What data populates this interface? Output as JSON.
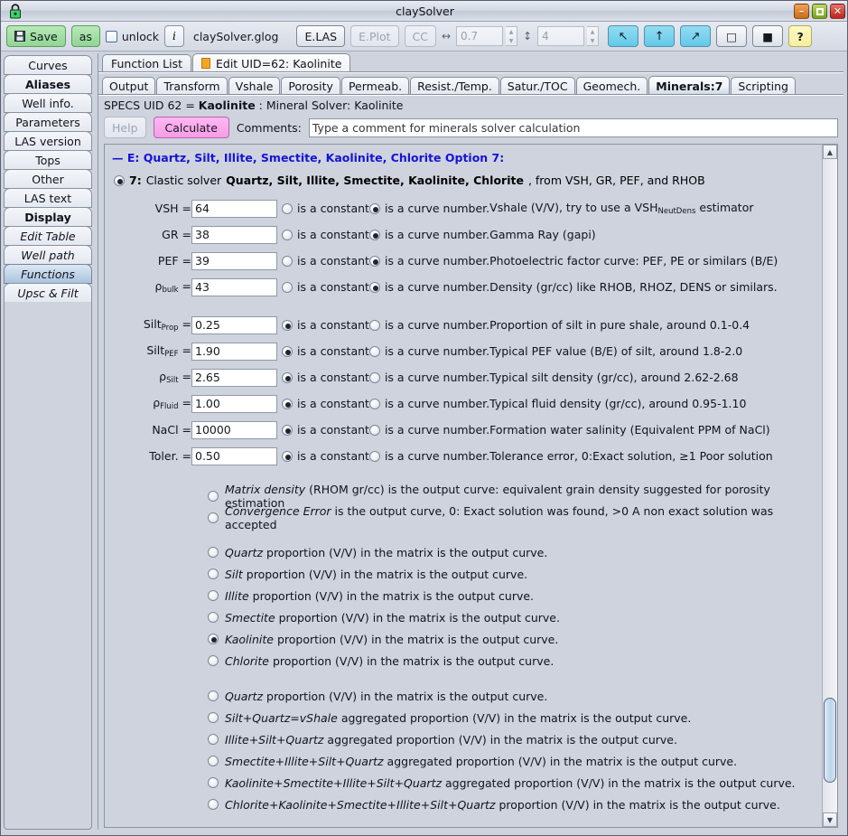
{
  "window": {
    "title": "claySolver",
    "lock_icon": "lock-icon",
    "minimize_label": "–",
    "maximize_label": "□",
    "close_label": "✕"
  },
  "toolbar": {
    "save_label": "Save",
    "save_icon": "floppy-disk-icon",
    "as_label": "as",
    "unlock_label": "unlock",
    "info_label": "i",
    "filename": "claySolver.glog",
    "elas_label": "E.LAS",
    "eplot_label": "E.Plot",
    "cc_label": "CC",
    "width_symbol": "↔",
    "width_value": "0.7",
    "height_symbol": "↕",
    "height_value": "4",
    "nav_back_label": "↖",
    "nav_up_label": "↑",
    "nav_fwd_label": "↗",
    "outline_label": "□",
    "filled_label": "■",
    "help_label": "?"
  },
  "sidebar": {
    "items": [
      {
        "label": "Curves",
        "style": "normal",
        "active": false
      },
      {
        "label": "Aliases",
        "style": "bold",
        "active": false
      },
      {
        "label": "Well info.",
        "style": "normal",
        "active": false
      },
      {
        "label": "Parameters",
        "style": "normal",
        "active": false
      },
      {
        "label": "LAS version",
        "style": "normal",
        "active": false
      },
      {
        "label": "Tops",
        "style": "normal",
        "active": false
      },
      {
        "label": "Other",
        "style": "normal",
        "active": false
      },
      {
        "label": "LAS text",
        "style": "normal",
        "active": false
      },
      {
        "label": "Display",
        "style": "bold",
        "active": false
      },
      {
        "label": "Edit Table",
        "style": "italic",
        "active": false
      },
      {
        "label": "Well path",
        "style": "italic",
        "active": false
      },
      {
        "label": "Functions",
        "style": "italic",
        "active": true
      },
      {
        "label": "Upsc & Filt",
        "style": "italic",
        "active": false
      }
    ]
  },
  "outer_tabs": [
    {
      "label": "Function List",
      "active": false,
      "marker": false
    },
    {
      "label": "Edit UID=62: Kaolinite",
      "active": true,
      "marker": true
    }
  ],
  "inner_tabs": [
    {
      "label": "Output",
      "active": false
    },
    {
      "label": "Transform",
      "active": false
    },
    {
      "label": "Vshale",
      "active": false
    },
    {
      "label": "Porosity",
      "active": false
    },
    {
      "label": "Permeab.",
      "active": false
    },
    {
      "label": "Resist./Temp.",
      "active": false
    },
    {
      "label": "Satur./TOC",
      "active": false
    },
    {
      "label": "Geomech.",
      "active": false
    },
    {
      "label": "Minerals:7",
      "active": true
    },
    {
      "label": "Scripting",
      "active": false
    }
  ],
  "specs": {
    "prefix": "SPECS UID 62 = ",
    "name": "Kaolinite",
    "suffix": " : Mineral Solver: Kaolinite"
  },
  "actions": {
    "help_label": "Help",
    "calculate_label": "Calculate",
    "comments_label": "Comments:",
    "comment_value": "Type a comment for minerals solver calculation"
  },
  "content": {
    "group_title": "— E: Quartz, Silt, Illite, Smectite, Kaolinite, Chlorite Option 7:",
    "option7": {
      "selected": true,
      "number": "7:",
      "text_before": "Clastic solver",
      "minerals": "Quartz, Silt, Illite, Smectite, Kaolinite, Chlorite",
      "text_after": ", from VSH, GR, PEF, and RHOB"
    },
    "constant_label": "is a constant",
    "curve_label": "is a curve number.",
    "params": [
      {
        "label": "VSH =",
        "label_sub": "",
        "value": "64",
        "mode": "curve",
        "desc_pre": "Vshale (V/V), try to use a VSH",
        "desc_sub": "NeutDens",
        "desc_post": " estimator"
      },
      {
        "label": "GR =",
        "label_sub": "",
        "value": "38",
        "mode": "curve",
        "desc_pre": "Gamma Ray (gapi)",
        "desc_sub": "",
        "desc_post": ""
      },
      {
        "label": "PEF =",
        "label_sub": "",
        "value": "39",
        "mode": "curve",
        "desc_pre": "Photoelectric factor curve: PEF, PE or similars (B/E)",
        "desc_sub": "",
        "desc_post": ""
      },
      {
        "label": "ρ",
        "label_sub": "bulk",
        "label_eq": " =",
        "value": "43",
        "mode": "curve",
        "desc_pre": "Density (gr/cc) like RHOB, RHOZ, DENS or similars.",
        "desc_sub": "",
        "desc_post": ""
      },
      {
        "gap": true
      },
      {
        "label": "Silt",
        "label_sub": "Prop",
        "label_eq": " =",
        "value": "0.25",
        "mode": "constant",
        "desc_pre": "Proportion of silt in pure shale, around 0.1-0.4",
        "desc_sub": "",
        "desc_post": ""
      },
      {
        "label": "Silt",
        "label_sub": "PEF",
        "label_eq": " =",
        "value": "1.90",
        "mode": "constant",
        "desc_pre": "Typical PEF value (B/E) of silt, around 1.8-2.0",
        "desc_sub": "",
        "desc_post": ""
      },
      {
        "label": "ρ",
        "label_sub": "Silt",
        "label_eq": " =",
        "value": "2.65",
        "mode": "constant",
        "desc_pre": "Typical silt density (gr/cc), around 2.62-2.68",
        "desc_sub": "",
        "desc_post": ""
      },
      {
        "label": "ρ",
        "label_sub": "Fluid",
        "label_eq": " =",
        "value": "1.00",
        "mode": "constant",
        "desc_pre": "Typical fluid density (gr/cc), around 0.95-1.10",
        "desc_sub": "",
        "desc_post": ""
      },
      {
        "label": "NaCl =",
        "label_sub": "",
        "value": "10000",
        "mode": "constant",
        "desc_pre": "Formation water salinity (Equivalent PPM of NaCl)",
        "desc_sub": "",
        "desc_post": ""
      },
      {
        "label": "Toler. =",
        "label_sub": "",
        "value": "0.50",
        "mode": "constant",
        "desc_pre": "Tolerance error, 0:Exact solution, ≥1 Poor solution",
        "desc_sub": "",
        "desc_post": ""
      }
    ],
    "output_options_a": [
      {
        "em": "Matrix density",
        "rest": " (RHOM gr/cc) is the output curve: equivalent grain density suggested for porosity estimation",
        "selected": false
      },
      {
        "em": "Convergence Error",
        "rest": " is the output curve, 0: Exact solution was found, >0 A non exact solution was accepted",
        "selected": false
      }
    ],
    "output_options_b": [
      {
        "em": "Quartz",
        "rest": " proportion (V/V) in the matrix is the output curve.",
        "selected": false
      },
      {
        "em": "Silt",
        "rest": " proportion (V/V) in the matrix is the output curve.",
        "selected": false
      },
      {
        "em": "Illite",
        "rest": " proportion (V/V) in the matrix is the output curve.",
        "selected": false
      },
      {
        "em": "Smectite",
        "rest": " proportion (V/V) in the matrix is the output curve.",
        "selected": false
      },
      {
        "em": "Kaolinite",
        "rest": " proportion (V/V) in the matrix is the output curve.",
        "selected": true
      },
      {
        "em": "Chlorite",
        "rest": " proportion (V/V) in the matrix is the output curve.",
        "selected": false
      }
    ],
    "output_options_c": [
      {
        "em": "Quartz",
        "rest": " proportion (V/V) in the matrix is the output curve.",
        "selected": false
      },
      {
        "em": "Silt+Quartz=vShale",
        "rest": " aggregated proportion (V/V) in the matrix is the output curve.",
        "selected": false
      },
      {
        "em": "Illite+Silt+Quartz",
        "rest": " aggregated proportion (V/V) in the matrix is the output curve.",
        "selected": false
      },
      {
        "em": "Smectite+Illite+Silt+Quartz",
        "rest": " aggregated proportion (V/V) in the matrix is the output curve.",
        "selected": false
      },
      {
        "em": "Kaolinite+Smectite+Illite+Silt+Quartz",
        "rest": " aggregated proportion (V/V) in the matrix is the output curve.",
        "selected": false
      },
      {
        "em": "Chlorite+Kaolinite+Smectite+Illite+Silt+Quartz",
        "rest": " proportion (V/V) in the matrix is the output curve.",
        "selected": false
      }
    ]
  },
  "scrollbar": {
    "up_arrow": "▲",
    "down_arrow": "▼"
  },
  "colors": {
    "window_bg": "#ced3de",
    "accent_blue": "#1414d6",
    "calculate_pink": "#f79ce8",
    "save_green": "#8fd693",
    "nav_cyan": "#63c9e9",
    "help_yellow": "#f6efa0",
    "tab_marker_orange": "#f5a623"
  }
}
